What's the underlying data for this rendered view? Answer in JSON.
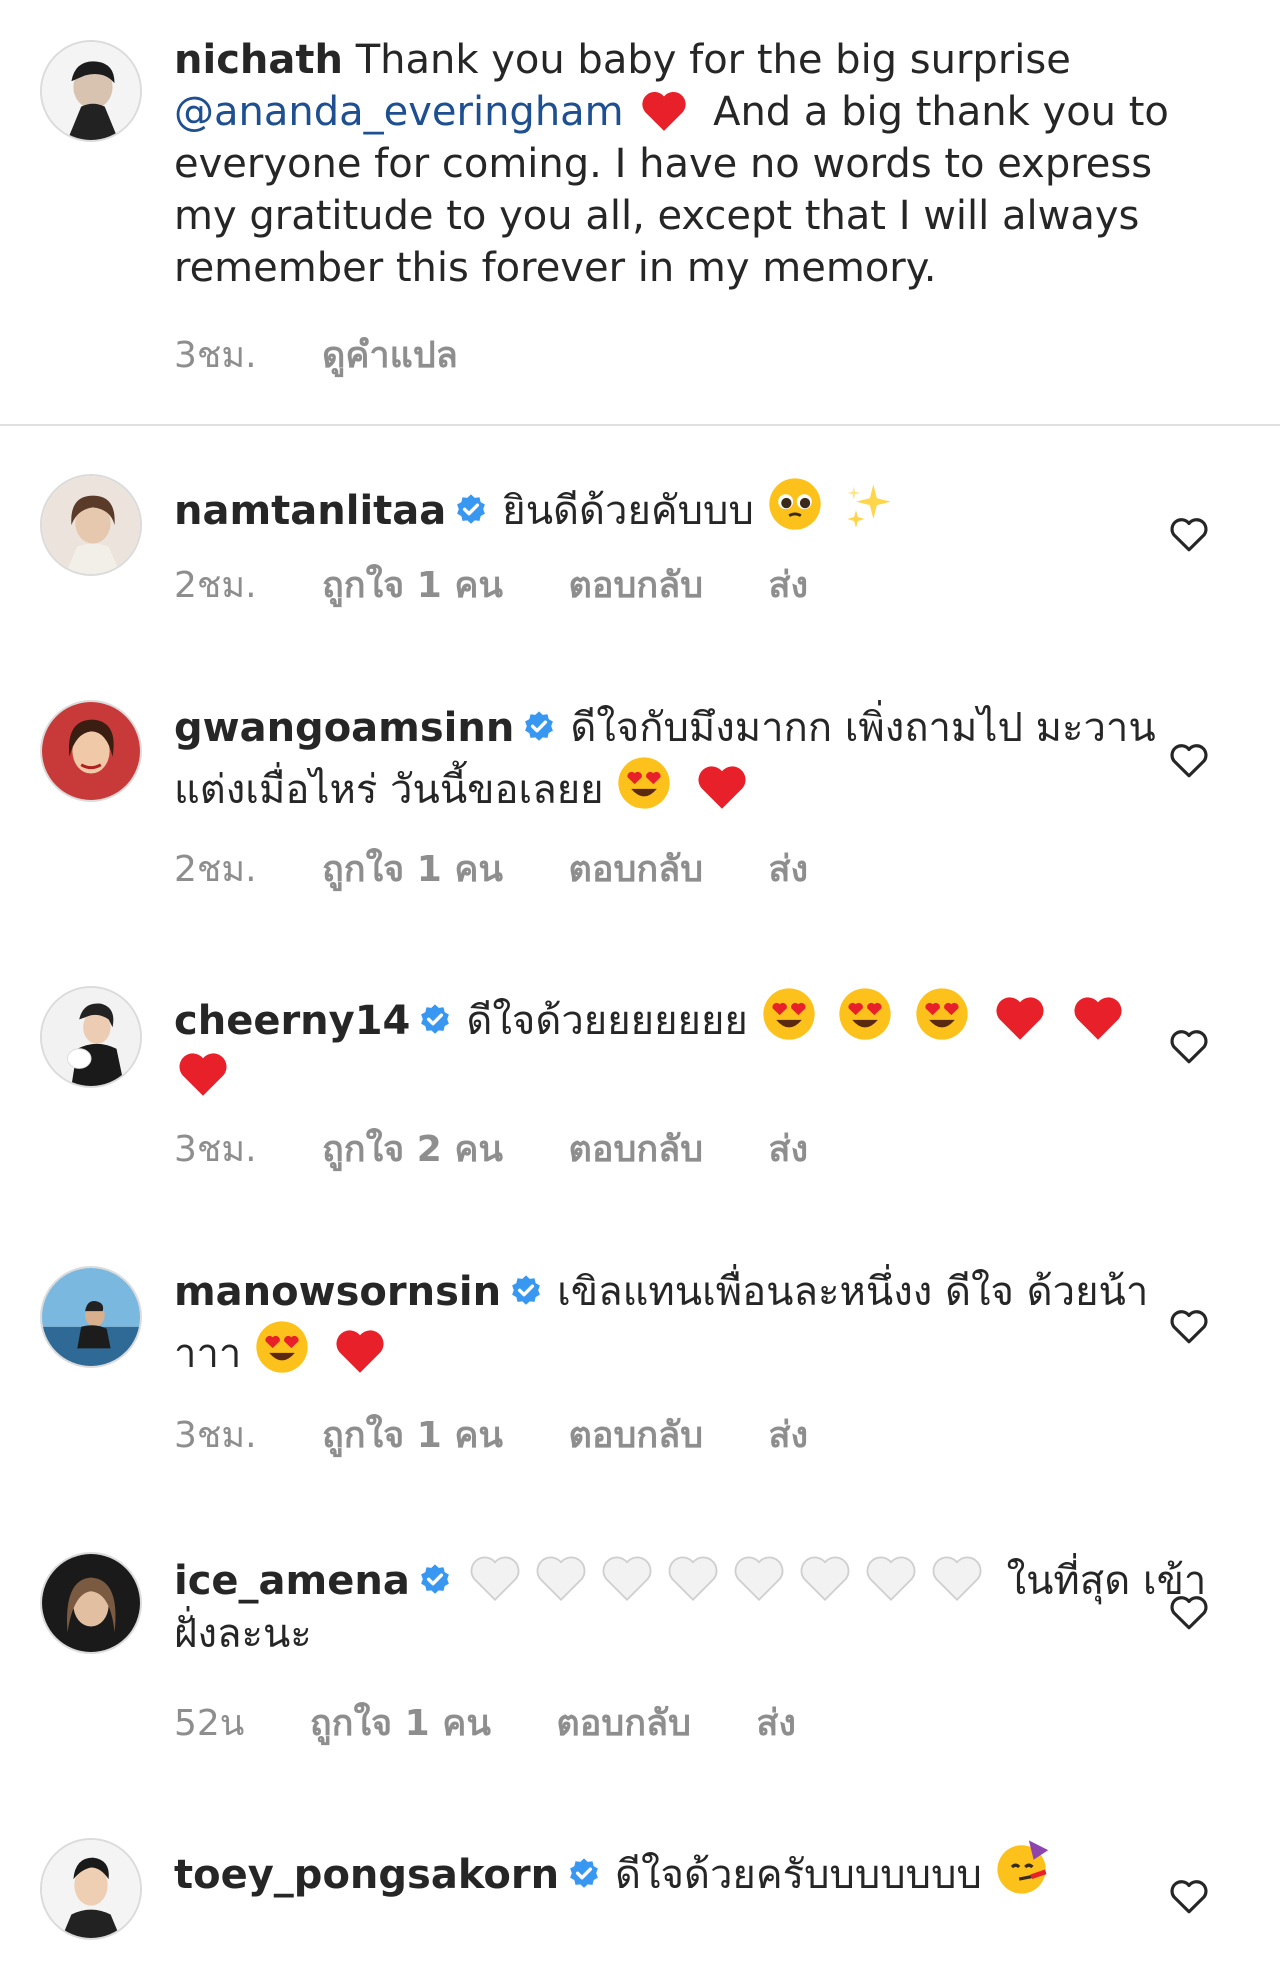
{
  "caption": {
    "username": "nichath",
    "text_1": "Thank you baby for the big surprise",
    "mention": "@ananda_everingham",
    "text_2": "And a big thank you to everyone for coming. I have no words to express my gratitude to you all, except that I will always remember this forever in my memory.",
    "time": "3ชม.",
    "translate": "ดูคำแปล"
  },
  "comments": [
    {
      "username": "namtanlitaa",
      "text": "ยินดีด้วยคับบบ",
      "emojis": [
        "pleading-face",
        "sparkles"
      ],
      "time": "2ชม.",
      "likes": "ถูกใจ 1 คน",
      "reply": "ตอบกลับ",
      "send": "ส่ง"
    },
    {
      "username": "gwangoamsinn",
      "text": "ดีใจกับมึงมากก เพิ่งถามไป มะวานแต่งเมื่อไหร่ วันนี้ขอเลยย",
      "emojis": [
        "heart-eyes",
        "red-heart"
      ],
      "time": "2ชม.",
      "likes": "ถูกใจ 1 คน",
      "reply": "ตอบกลับ",
      "send": "ส่ง"
    },
    {
      "username": "cheerny14",
      "text": "ดีใจด้วยยยยยยย",
      "emojis": [
        "heart-eyes",
        "heart-eyes",
        "heart-eyes",
        "red-heart",
        "red-heart",
        "red-heart"
      ],
      "time": "3ชม.",
      "likes": "ถูกใจ 2 คน",
      "reply": "ตอบกลับ",
      "send": "ส่ง"
    },
    {
      "username": "manowsornsin",
      "text": "เขิลแทนเพื่อนละหนึ่งง  ดีใจ ด้วยน้าาาา",
      "emojis": [
        "heart-eyes",
        "red-heart"
      ],
      "time": "3ชม.",
      "likes": "ถูกใจ 1 คน",
      "reply": "ตอบกลับ",
      "send": "ส่ง"
    },
    {
      "username": "ice_amena",
      "text_after": "ในที่สุด เข้าฝั่งละนะ",
      "emojis": [
        "white-heart",
        "white-heart",
        "white-heart",
        "white-heart",
        "white-heart",
        "white-heart",
        "white-heart",
        "white-heart"
      ],
      "time": "52น",
      "likes": "ถูกใจ 1 คน",
      "reply": "ตอบกลับ",
      "send": "ส่ง"
    },
    {
      "username": "toey_pongsakorn",
      "text": "ดีใจด้วยครับบบบบบบ",
      "emojis": [
        "partying-face"
      ]
    }
  ],
  "colors": {
    "text": "#262626",
    "meta": "#8e8e8e",
    "mention": "#1d4f91",
    "verified": "#3897f0",
    "heart": "#e8202a",
    "divider": "#e0e0e0"
  }
}
